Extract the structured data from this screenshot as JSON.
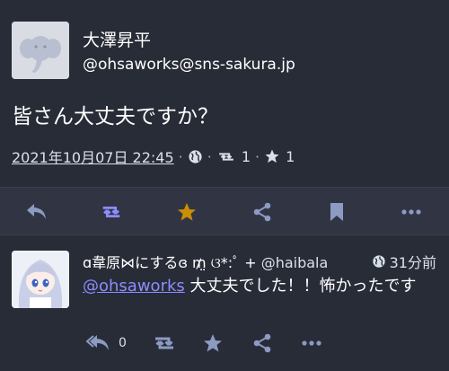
{
  "status": {
    "display_name": "大澤昇平",
    "acct": "@ohsaworks@sns-sakura.jp",
    "content": "皆さん大丈夫ですか？",
    "date": "2021年10月07日 22:45",
    "visibility_icon": "globe-icon",
    "boost_count": "1",
    "favourite_count": "1",
    "avatar_icon": "elephant-icon"
  },
  "action_bar": {
    "icons": [
      "reply-icon",
      "boost-icon",
      "star-icon",
      "share-icon",
      "bookmark-icon",
      "more-icon"
    ],
    "favourited_color": "#ca8f04",
    "boosted_color": "#8c8dff",
    "default_color": "#8d9ac2"
  },
  "reply": {
    "display_name": "ɑ韋原⋈にするɞ ₥̤ ଓ*:ﾟ +",
    "acct": "@haibala",
    "time": "31分前",
    "mention": "@ohsaworks",
    "text": " 大丈夫でした！！怖かったです",
    "reply_count": "0",
    "avatar_icon": "anime-girl-avatar"
  },
  "colors": {
    "background": "#282c37",
    "action_bar_bg": "#313543",
    "link": "#8c8dff",
    "secondary_text": "#d9e1e8"
  }
}
